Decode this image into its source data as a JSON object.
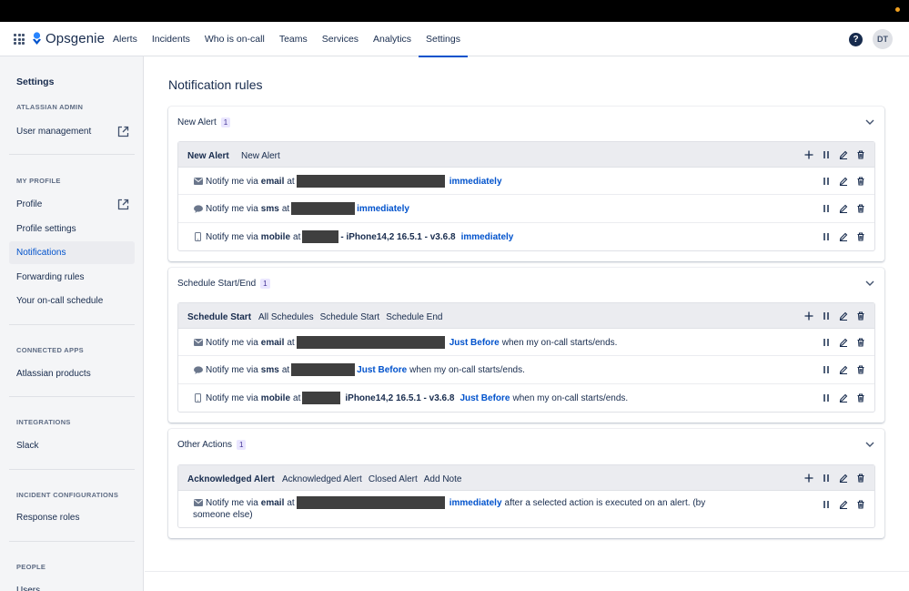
{
  "app": {
    "name": "Opsgenie"
  },
  "nav": {
    "items": [
      "Alerts",
      "Incidents",
      "Who is on-call",
      "Teams",
      "Services",
      "Analytics",
      "Settings"
    ],
    "active": "Settings",
    "avatar": "DT",
    "help": "?"
  },
  "sidebar": {
    "title": "Settings",
    "sections": {
      "atlassian_admin": "ATLASSIAN ADMIN",
      "my_profile": "MY PROFILE",
      "connected_apps": "CONNECTED APPS",
      "integrations": "INTEGRATIONS",
      "incident_configurations": "INCIDENT CONFIGURATIONS",
      "people": "PEOPLE"
    },
    "items": {
      "user_management": "User management",
      "profile": "Profile",
      "profile_settings": "Profile settings",
      "notifications": "Notifications",
      "forwarding_rules": "Forwarding rules",
      "on_call_schedule": "Your on-call schedule",
      "atlassian_products": "Atlassian products",
      "slack": "Slack",
      "response_roles": "Response roles",
      "users": "Users"
    }
  },
  "page": {
    "title": "Notification rules"
  },
  "common": {
    "notify_prefix": "Notify me via",
    "at": "at",
    "email": "email",
    "sms": "sms",
    "mobile": "mobile",
    "immediately": "immediately",
    "just_before": "Just Before",
    "on_call_suffix": "when my on-call starts/ends.",
    "device": "iPhone14,2 16.5.1 - v3.6.8",
    "device_dash": "- iPhone14,2 16.5.1 - v3.6.8",
    "action_suffix_1": "after a selected action is executed on an alert. (by",
    "action_suffix_2": "someone else)"
  },
  "cards": {
    "new_alert": {
      "title": "New Alert",
      "count": "1",
      "rule_name": "New Alert",
      "tags": [
        "New Alert"
      ]
    },
    "schedule": {
      "title": "Schedule Start/End",
      "count": "1",
      "rule_name": "Schedule Start",
      "tags": [
        "All Schedules",
        "Schedule Start",
        "Schedule End"
      ]
    },
    "other": {
      "title": "Other Actions",
      "count": "1",
      "rule_name": "Acknowledged Alert",
      "tags": [
        "Acknowledged Alert",
        "Closed Alert",
        "Add Note"
      ]
    }
  },
  "colors": {
    "accent": "#0052cc",
    "redaction": "#3f3f3f",
    "sidebar_bg": "#f4f5f7"
  }
}
